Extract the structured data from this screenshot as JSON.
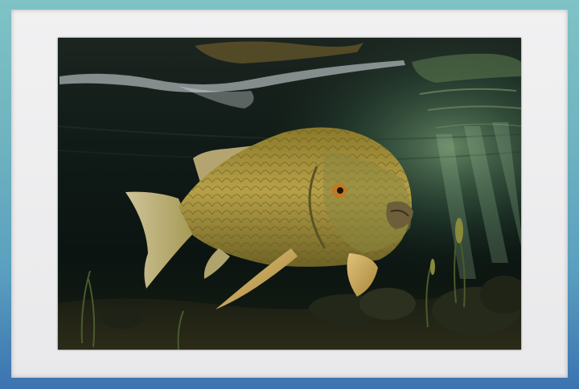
{
  "scene": {
    "subject": "underwater carp",
    "frame_color": "#5fa7b4",
    "mat_color": "#ececee",
    "water_color": "#0d1512",
    "fish_color": "#b79a3c"
  }
}
